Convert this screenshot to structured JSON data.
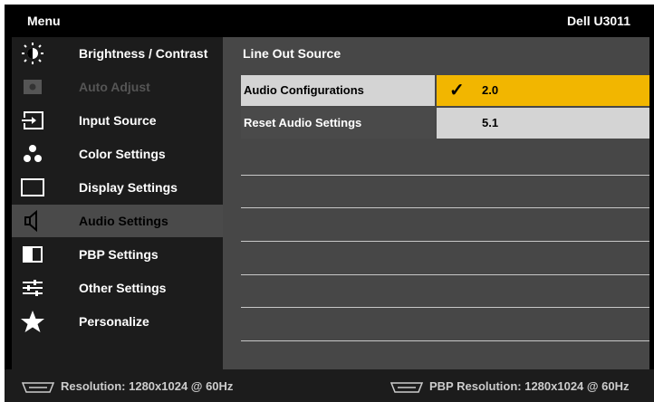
{
  "header": {
    "menu_label": "Menu",
    "model": "Dell U3011"
  },
  "sidebar": {
    "items": [
      {
        "label": "Brightness / Contrast",
        "icon": "brightness-icon",
        "state": "normal"
      },
      {
        "label": "Auto Adjust",
        "icon": "auto-adjust-icon",
        "state": "disabled"
      },
      {
        "label": "Input Source",
        "icon": "input-source-icon",
        "state": "normal"
      },
      {
        "label": "Color Settings",
        "icon": "color-settings-icon",
        "state": "normal"
      },
      {
        "label": "Display Settings",
        "icon": "display-settings-icon",
        "state": "normal"
      },
      {
        "label": "Audio Settings",
        "icon": "speaker-icon",
        "state": "selected"
      },
      {
        "label": "PBP Settings",
        "icon": "pbp-icon",
        "state": "normal"
      },
      {
        "label": "Other Settings",
        "icon": "sliders-icon",
        "state": "normal"
      },
      {
        "label": "Personalize",
        "icon": "star-icon",
        "state": "normal"
      }
    ]
  },
  "content": {
    "title": "Line Out Source",
    "rows": [
      {
        "label": "Audio Configurations",
        "value": "2.0",
        "checked": true
      },
      {
        "label": "Reset Audio Settings",
        "value": "5.1",
        "checked": false
      }
    ]
  },
  "footer": {
    "resolution": "Resolution: 1280x1024 @ 60Hz",
    "pbp_resolution": "PBP Resolution: 1280x1024 @ 60Hz"
  },
  "colors": {
    "accent": "#f2b600",
    "panel": "#474747",
    "sidebar": "#1c1c1c",
    "selected": "#4a4a4a"
  }
}
